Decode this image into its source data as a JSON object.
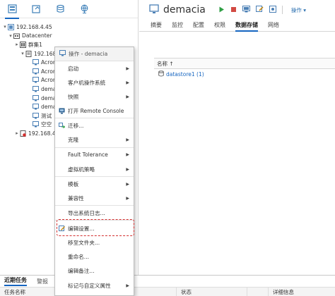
{
  "nav": {
    "icons": [
      "hosts-clusters-icon",
      "vms-templates-icon",
      "storage-icon",
      "networking-icon"
    ]
  },
  "tree": {
    "items": [
      {
        "label": "192.168.4.45",
        "level": 0,
        "expanded": true,
        "icon": "vcenter-icon"
      },
      {
        "label": "Datacenter",
        "level": 1,
        "expanded": true,
        "icon": "datacenter-icon"
      },
      {
        "label": "群集1",
        "level": 2,
        "expanded": false,
        "icon": "cluster-icon"
      },
      {
        "label": "192.168.4.",
        "level": 2,
        "expanded": true,
        "icon": "host-icon"
      },
      {
        "label": "Acron",
        "level": 3,
        "icon": "vm-icon"
      },
      {
        "label": "Acron",
        "level": 3,
        "icon": "vm-icon"
      },
      {
        "label": "Acron",
        "level": 3,
        "icon": "vm-icon"
      },
      {
        "label": "dema",
        "level": 3,
        "icon": "vm-icon",
        "selected": true
      },
      {
        "label": "dema",
        "level": 3,
        "icon": "vm-icon"
      },
      {
        "label": "dema",
        "level": 3,
        "icon": "vm-icon"
      },
      {
        "label": "测试",
        "level": 3,
        "icon": "vm-icon"
      },
      {
        "label": "空空",
        "level": 3,
        "icon": "vm-icon"
      },
      {
        "label": "192.168.4.",
        "level": 1,
        "expanded": false,
        "icon": "host-alert-icon"
      }
    ]
  },
  "vm": {
    "name": "demacia",
    "actions_label": "操作"
  },
  "tabs": [
    "摘要",
    "监控",
    "配置",
    "权限",
    "数据存储",
    "网络"
  ],
  "active_tab": "数据存储",
  "datastores": {
    "column_name": "名称 ↑",
    "rows": [
      "datastore1 (1)"
    ]
  },
  "context_menu": {
    "header": "操作 - demacia",
    "items": [
      {
        "label": "启动",
        "submenu": true
      },
      {
        "label": "客户机操作系统",
        "submenu": true
      },
      {
        "label": "快照",
        "submenu": true
      },
      {
        "label": "打开 Remote Console",
        "submenu": false,
        "icon": "remote-console-icon"
      },
      {
        "label": "迁移...",
        "submenu": false,
        "icon": "migrate-icon"
      },
      {
        "label": "克隆",
        "submenu": true
      },
      {
        "label": "Fault Tolerance",
        "submenu": true
      },
      {
        "label": "虚拟机策略",
        "submenu": true
      },
      {
        "label": "模板",
        "submenu": true
      },
      {
        "label": "兼容性",
        "submenu": true
      },
      {
        "label": "导出系统日志...",
        "submenu": false
      },
      {
        "label": "编辑设置...",
        "submenu": false,
        "icon": "edit-settings-icon",
        "highlighted": true
      },
      {
        "label": "移至文件夹...",
        "submenu": false
      },
      {
        "label": "重命名...",
        "submenu": false
      },
      {
        "label": "编辑备注...",
        "submenu": false
      },
      {
        "label": "标记与自定义属性",
        "submenu": true
      }
    ]
  },
  "bottom": {
    "tabs": [
      "近期任务",
      "警报"
    ],
    "columns": [
      "任务名称",
      "",
      "状态",
      "",
      "详细信息"
    ]
  },
  "colors": {
    "accent": "#1565c0",
    "highlight": "#d32f2f",
    "vm_on": "#2e9e44",
    "stop": "#d24a43"
  }
}
